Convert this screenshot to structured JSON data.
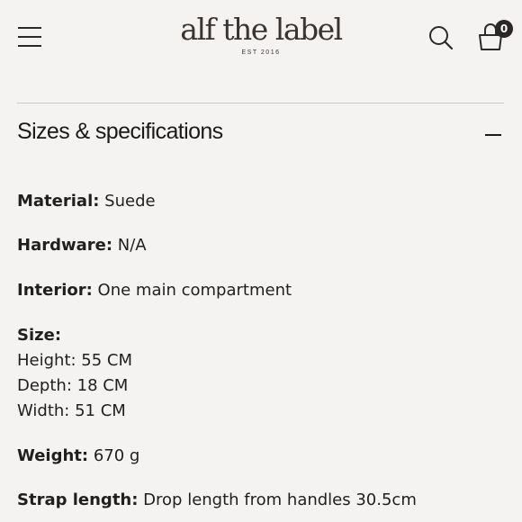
{
  "header": {
    "logo_text": "alf the label",
    "logo_subtext": "EST 2016",
    "cart_count": "0"
  },
  "section": {
    "title": "Sizes & specifications"
  },
  "specs": {
    "material": {
      "label": "Material:",
      "value": "Suede"
    },
    "hardware": {
      "label": "Hardware:",
      "value": "N/A"
    },
    "interior": {
      "label": "Interior:",
      "value": "One main compartment"
    },
    "size": {
      "label": "Size:",
      "lines": [
        "Height: 55 CM",
        "Depth: 18 CM",
        "Width: 51 CM"
      ]
    },
    "weight": {
      "label": "Weight:",
      "value": "670 g"
    },
    "strap": {
      "label": "Strap length:",
      "value": "Drop length from handles 30.5cm"
    }
  },
  "icons": {
    "menu": "hamburger-menu-icon",
    "search": "search-icon",
    "cart": "shopping-bag-icon",
    "collapse": "minus-icon"
  }
}
